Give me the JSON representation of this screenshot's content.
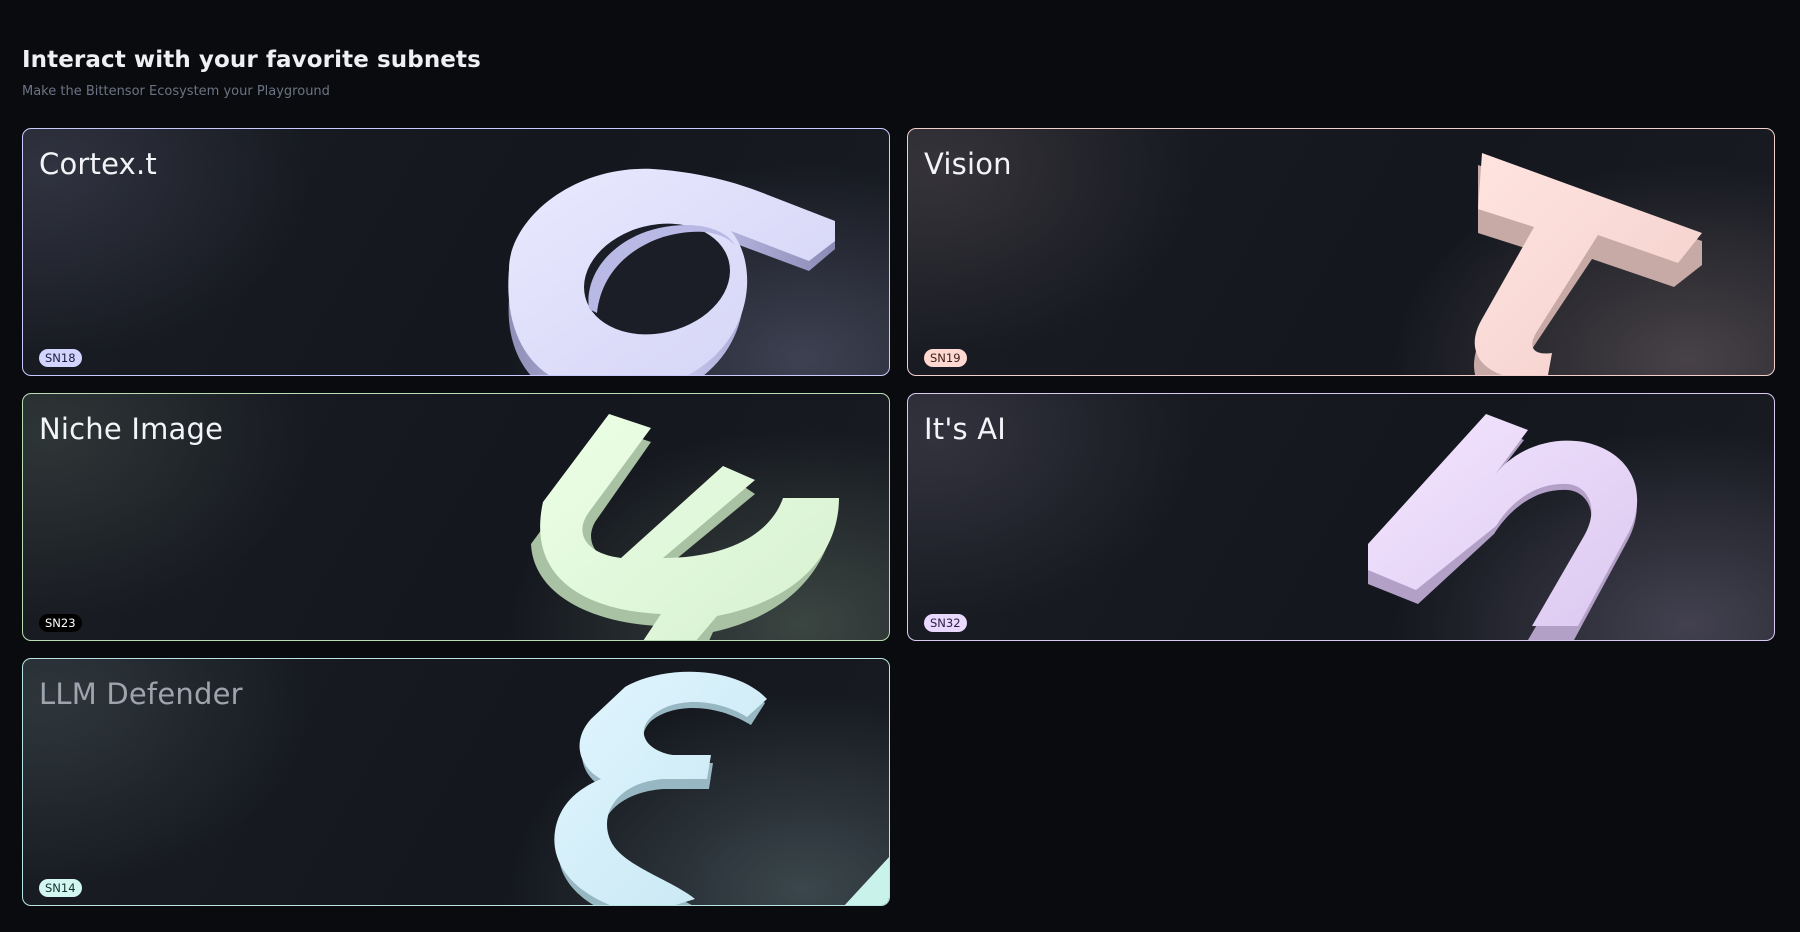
{
  "header": {
    "title": "Interact with your favorite subnets",
    "subtitle": "Make the Bittensor Ecosystem your Playground"
  },
  "cards": [
    {
      "name": "Cortex.t",
      "badge": "SN18",
      "symbol": "sigma-symbol-icon",
      "accent": "#c9cbff",
      "badge_bg": "#d2d5ff",
      "badge_fg": "#1b1e3a"
    },
    {
      "name": "Vision",
      "badge": "SN19",
      "symbol": "tau-symbol-icon",
      "accent": "#f2cfcb",
      "badge_bg": "#ffd8d2",
      "badge_fg": "#3a1b18"
    },
    {
      "name": "Niche Image",
      "badge": "SN23",
      "symbol": "psi-symbol-icon",
      "accent": "#b9ddb4",
      "badge_bg": "#000000",
      "badge_fg": "#ffffff"
    },
    {
      "name": "It's AI",
      "badge": "SN32",
      "symbol": "eta-symbol-icon",
      "accent": "#dcc9f2",
      "badge_bg": "#ead9ff",
      "badge_fg": "#2a1c3a"
    },
    {
      "name": "LLM Defender",
      "badge": "SN14",
      "symbol": "epsilon-symbol-icon",
      "accent": "#b8e4e4",
      "badge_bg": "#d3f6f1",
      "badge_fg": "#12302c"
    }
  ]
}
